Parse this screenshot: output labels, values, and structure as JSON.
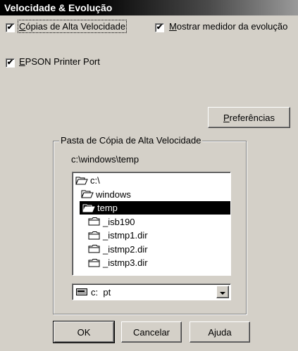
{
  "window": {
    "title": "Velocidade & Evolução"
  },
  "options": {
    "high_speed_copies": {
      "label_u": "C",
      "label_rest": "ópias de Alta Velocidade",
      "checked": true
    },
    "show_progress": {
      "label_u": "M",
      "label_rest": "ostrar medidor da evolução",
      "checked": true
    },
    "epson_port": {
      "label_u": "E",
      "label_rest": "PSON Printer Port",
      "checked": true
    }
  },
  "preferences_button": {
    "label_u": "P",
    "label_rest": "referências"
  },
  "folder_group": {
    "title": "Pasta de Cópia de Alta Velocidade",
    "current_path": "c:\\windows\\temp",
    "directories": [
      {
        "name": "c:\\",
        "icon": "open-folder-icon",
        "selected": false
      },
      {
        "name": "windows",
        "icon": "open-folder-icon",
        "selected": false
      },
      {
        "name": "temp",
        "icon": "open-folder-icon",
        "selected": true
      },
      {
        "name": "_isb190",
        "icon": "folder-icon",
        "selected": false
      },
      {
        "name": "_istmp1.dir",
        "icon": "folder-icon",
        "selected": false
      },
      {
        "name": "_istmp2.dir",
        "icon": "folder-icon",
        "selected": false
      },
      {
        "name": "_istmp3.dir",
        "icon": "folder-icon",
        "selected": false
      }
    ],
    "drive": {
      "value": "c:  pt",
      "icon": "drive-icon"
    }
  },
  "buttons": {
    "ok": "OK",
    "cancel": "Cancelar",
    "help": "Ajuda"
  }
}
